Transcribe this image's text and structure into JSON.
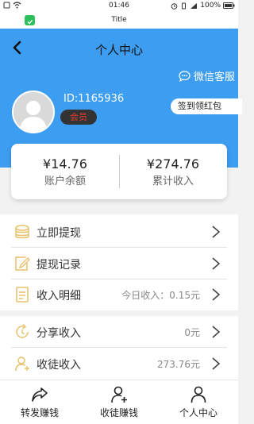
{
  "status_bar": {
    "time": "01:46",
    "battery": "100%"
  },
  "app_bar": {
    "title": "Title"
  },
  "header": {
    "title": "个人中心",
    "service_label": "微信客服",
    "user_id": "ID:1165936",
    "member_badge": "会员",
    "checkin_label": "签到领红包"
  },
  "summary": {
    "balance_amount": "¥14.76",
    "balance_label": "账户余额",
    "total_amount": "¥274.76",
    "total_label": "累计收入"
  },
  "menu": [
    {
      "label": "立即提现",
      "value": ""
    },
    {
      "label": "提现记录",
      "value": ""
    },
    {
      "label": "收入明细",
      "value": "今日收入：0.15元"
    },
    {
      "label": "分享收入",
      "value": "0元"
    },
    {
      "label": "收徒收入",
      "value": "273.76元"
    }
  ],
  "bottom_nav": [
    {
      "label": "转发赚钱"
    },
    {
      "label": "收徒赚钱"
    },
    {
      "label": "个人中心"
    }
  ],
  "colors": {
    "header_blue": "#3d9df0",
    "icon_gold": "#e8c16a",
    "badge_red": "#e43b2d"
  }
}
